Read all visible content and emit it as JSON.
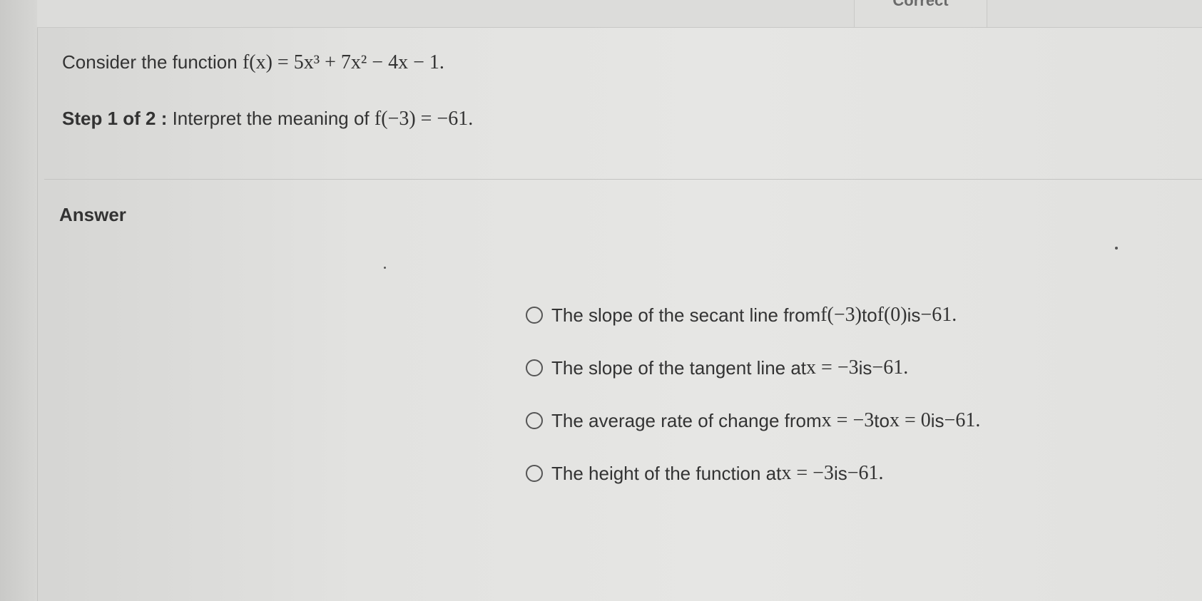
{
  "header": {
    "tab_label": "Correct"
  },
  "question": {
    "intro": "Consider the function ",
    "function_math": "f(x) = 5x³ + 7x² − 4x − 1."
  },
  "step": {
    "label": "Step 1 of 2 :",
    "prompt": " Interpret the meaning of ",
    "math": "f(−3) = −61."
  },
  "answer": {
    "heading": "Answer",
    "options": [
      {
        "t1": "The slope of the secant line from ",
        "m1": "f(−3)",
        "t2": " to ",
        "m2": "f(0)",
        "t3": " is ",
        "m3": "−61."
      },
      {
        "t1": "The slope of the tangent line at ",
        "m1": "x = −3",
        "t2": " is ",
        "m2": "−61."
      },
      {
        "t1": "The average rate of change from ",
        "m1": "x = −3",
        "t2": " to ",
        "m2": "x = 0",
        "t3": " is ",
        "m3": "−61."
      },
      {
        "t1": "The height of the function at ",
        "m1": "x = −3",
        "t2": " is ",
        "m2": "−61."
      }
    ]
  }
}
